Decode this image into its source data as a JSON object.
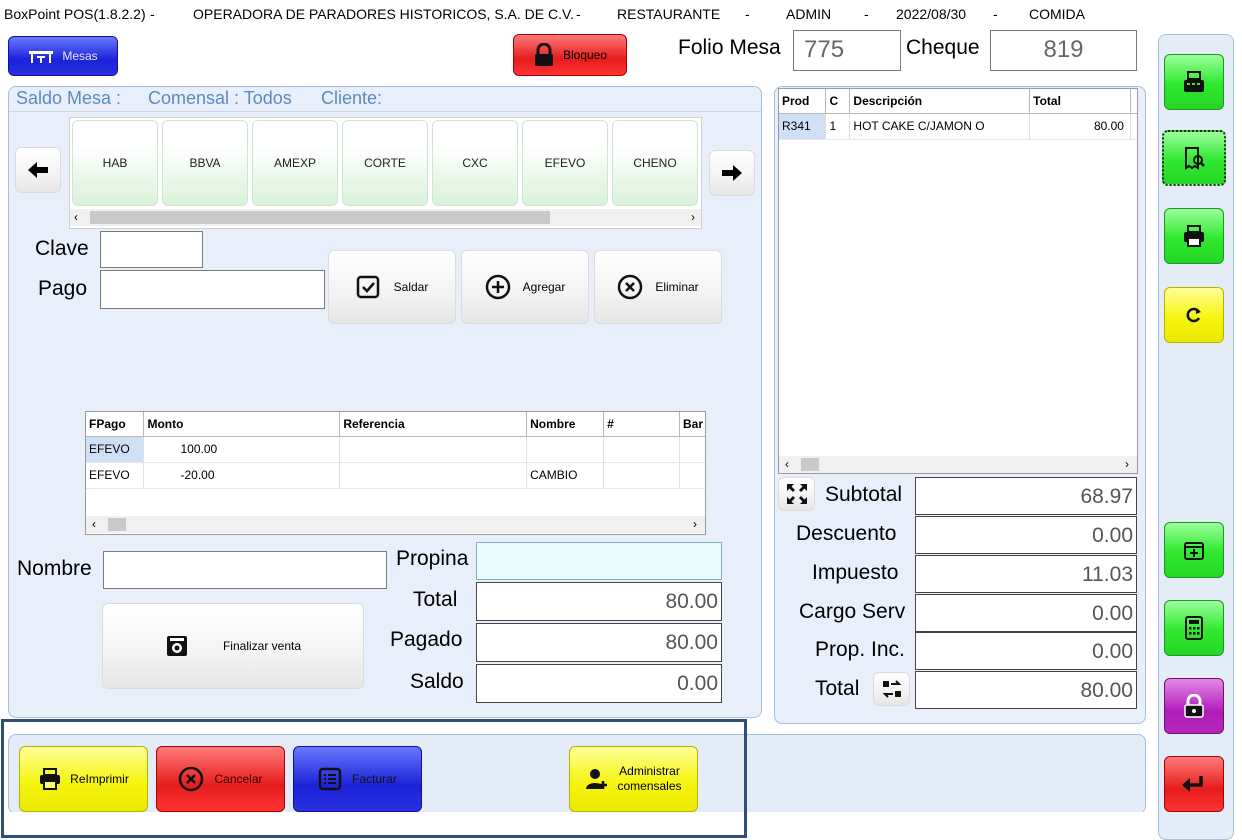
{
  "titlebar": {
    "app": "BoxPoint POS(1.8.2.2)",
    "sep": "-",
    "company": "OPERADORA DE PARADORES HISTORICOS, S.A. DE C.V.",
    "area": "RESTAURANTE",
    "user": "ADMIN",
    "date": "2022/08/30",
    "shift": "COMIDA"
  },
  "top": {
    "mesas_label": "Mesas",
    "bloqueo_label": "Bloqueo",
    "folio_label": "Folio Mesa",
    "folio_value": "775",
    "cheque_label": "Cheque",
    "cheque_value": "819"
  },
  "header_line": {
    "saldo": "Saldo Mesa :",
    "comensal": "Comensal : Todos",
    "cliente": "Cliente:"
  },
  "tenders": [
    "HAB",
    "BBVA",
    "AMEXP",
    "CORTE",
    "CXC",
    "EFEVO",
    "CHENO"
  ],
  "payment": {
    "clave_label": "Clave",
    "clave_value": "",
    "pago_label": "Pago",
    "pago_value": "",
    "saldar_label": "Saldar",
    "agregar_label": "Agregar",
    "eliminar_label": "Eliminar"
  },
  "payments_table": {
    "headers": [
      "FPago",
      "Monto",
      "Referencia",
      "Nombre",
      "#",
      "Bar"
    ],
    "rows": [
      [
        "EFEVO",
        "100.00",
        "",
        "",
        "",
        ""
      ],
      [
        "EFEVO",
        "-20.00",
        "",
        "CAMBIO",
        "",
        ""
      ]
    ]
  },
  "bottom_left": {
    "nombre_label": "Nombre",
    "nombre_value": "",
    "finalizar_label": "Finalizar venta",
    "propina_label": "Propina",
    "propina_value": "",
    "total_label": "Total",
    "total_value": "80.00",
    "pagado_label": "Pagado",
    "pagado_value": "80.00",
    "saldo_label": "Saldo",
    "saldo_value": "0.00"
  },
  "order_table": {
    "headers": [
      "Prod",
      "C",
      "Descripción",
      "Total"
    ],
    "rows": [
      [
        "R341",
        "1",
        "HOT CAKE C/JAMON O",
        "80.00"
      ]
    ]
  },
  "totals": {
    "subtotal_label": "Subtotal",
    "subtotal_value": "68.97",
    "descuento_label": "Descuento",
    "descuento_value": "0.00",
    "impuesto_label": "Impuesto",
    "impuesto_value": "11.03",
    "cargo_label": "Cargo Serv",
    "cargo_value": "0.00",
    "prop_label": "Prop. Inc.",
    "prop_value": "0.00",
    "total_label": "Total",
    "total_value": "80.00"
  },
  "footer": {
    "reimprimir_label": "ReImprimir",
    "cancelar_label": "Cancelar",
    "facturar_label": "Facturar",
    "admin_line1": "Administrar",
    "admin_line2": "comensales"
  },
  "side_icons": [
    "cash-register-icon",
    "receipt-search-icon",
    "printer-icon",
    "refresh-icon",
    "add-item-icon",
    "calculator-icon",
    "lock-icon",
    "return-icon"
  ],
  "colors": {
    "panel_bg": "#e8effa",
    "panel_border": "#a8c0dc",
    "selection": "#cfe0f6",
    "highlight_box": "#2f4f7a"
  }
}
